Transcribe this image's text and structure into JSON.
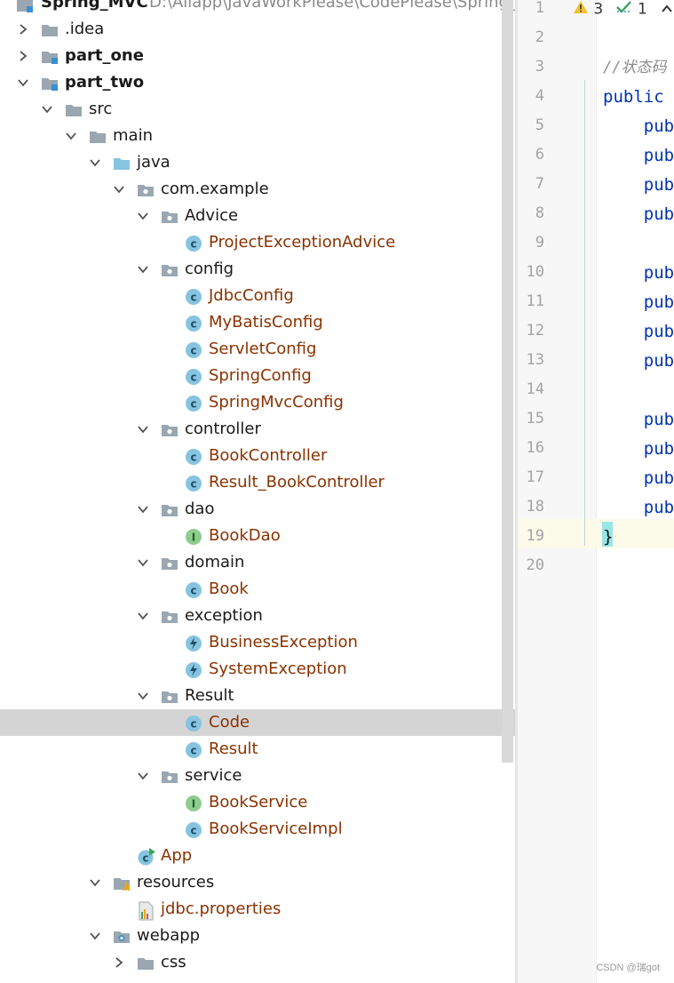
{
  "project": {
    "name": "Spring_MVC",
    "path": "D:\\Aliapp\\JavaWorkPlease\\CodePlease\\Spring_M"
  },
  "tree": [
    {
      "label": ".idea",
      "icon": "folder-icon",
      "expanded": false
    },
    {
      "label": "part_one",
      "icon": "module-icon",
      "expanded": false
    },
    {
      "label": "part_two",
      "icon": "module-icon",
      "expanded": true
    },
    {
      "label": "src",
      "icon": "folder-icon",
      "expanded": true
    },
    {
      "label": "main",
      "icon": "folder-icon",
      "expanded": true
    },
    {
      "label": "java",
      "icon": "source-folder-icon",
      "expanded": true
    },
    {
      "label": "com.example",
      "icon": "package-icon",
      "expanded": true
    },
    {
      "label": "Advice",
      "icon": "package-icon",
      "expanded": true
    },
    {
      "label": "ProjectExceptionAdvice",
      "icon": "class-icon"
    },
    {
      "label": "config",
      "icon": "package-icon",
      "expanded": true
    },
    {
      "label": "JdbcConfig",
      "icon": "class-icon"
    },
    {
      "label": "MyBatisConfig",
      "icon": "class-icon"
    },
    {
      "label": "ServletConfig",
      "icon": "class-icon"
    },
    {
      "label": "SpringConfig",
      "icon": "class-icon"
    },
    {
      "label": "SpringMvcConfig",
      "icon": "class-icon"
    },
    {
      "label": "controller",
      "icon": "package-icon",
      "expanded": true
    },
    {
      "label": "BookController",
      "icon": "class-icon"
    },
    {
      "label": "Result_BookController",
      "icon": "class-icon"
    },
    {
      "label": "dao",
      "icon": "package-icon",
      "expanded": true
    },
    {
      "label": "BookDao",
      "icon": "interface-icon"
    },
    {
      "label": "domain",
      "icon": "package-icon",
      "expanded": true
    },
    {
      "label": "Book",
      "icon": "class-icon"
    },
    {
      "label": "exception",
      "icon": "package-icon",
      "expanded": true
    },
    {
      "label": "BusinessException",
      "icon": "exception-class-icon"
    },
    {
      "label": "SystemException",
      "icon": "exception-class-icon"
    },
    {
      "label": "Result",
      "icon": "package-icon",
      "expanded": true
    },
    {
      "label": "Code",
      "icon": "class-icon",
      "selected": true
    },
    {
      "label": "Result",
      "icon": "class-icon"
    },
    {
      "label": "service",
      "icon": "package-icon",
      "expanded": true
    },
    {
      "label": "BookService",
      "icon": "interface-icon"
    },
    {
      "label": "BookServiceImpl",
      "icon": "class-icon"
    },
    {
      "label": "App",
      "icon": "runnable-class-icon"
    },
    {
      "label": "resources",
      "icon": "resources-folder-icon",
      "expanded": true
    },
    {
      "label": "jdbc.properties",
      "icon": "properties-file-icon"
    },
    {
      "label": "webapp",
      "icon": "web-folder-icon",
      "expanded": true
    },
    {
      "label": "css",
      "icon": "folder-icon",
      "expanded": false
    }
  ],
  "editor": {
    "warnings": "3",
    "weak_warnings": "1",
    "line_numbers": [
      "1",
      "2",
      "3",
      "4",
      "5",
      "6",
      "7",
      "8",
      "9",
      "10",
      "11",
      "12",
      "13",
      "14",
      "15",
      "16",
      "17",
      "18",
      "19",
      "20"
    ],
    "lines": [
      "",
      "",
      "//状态码",
      "public",
      "    pub",
      "    pub",
      "    pub",
      "    pub",
      "",
      "    pub",
      "    pub",
      "    pub",
      "    pub",
      "",
      "    pub",
      "    pub",
      "    pub",
      "    pub",
      "}",
      ""
    ]
  },
  "watermark": "CSDN @瑞got",
  "colors": {
    "class_name": "#8a3200",
    "keyword": "#0033b3",
    "selection": "#d4d4d4",
    "class_icon": "#86c4e0",
    "interface_icon": "#8fcc8f"
  }
}
